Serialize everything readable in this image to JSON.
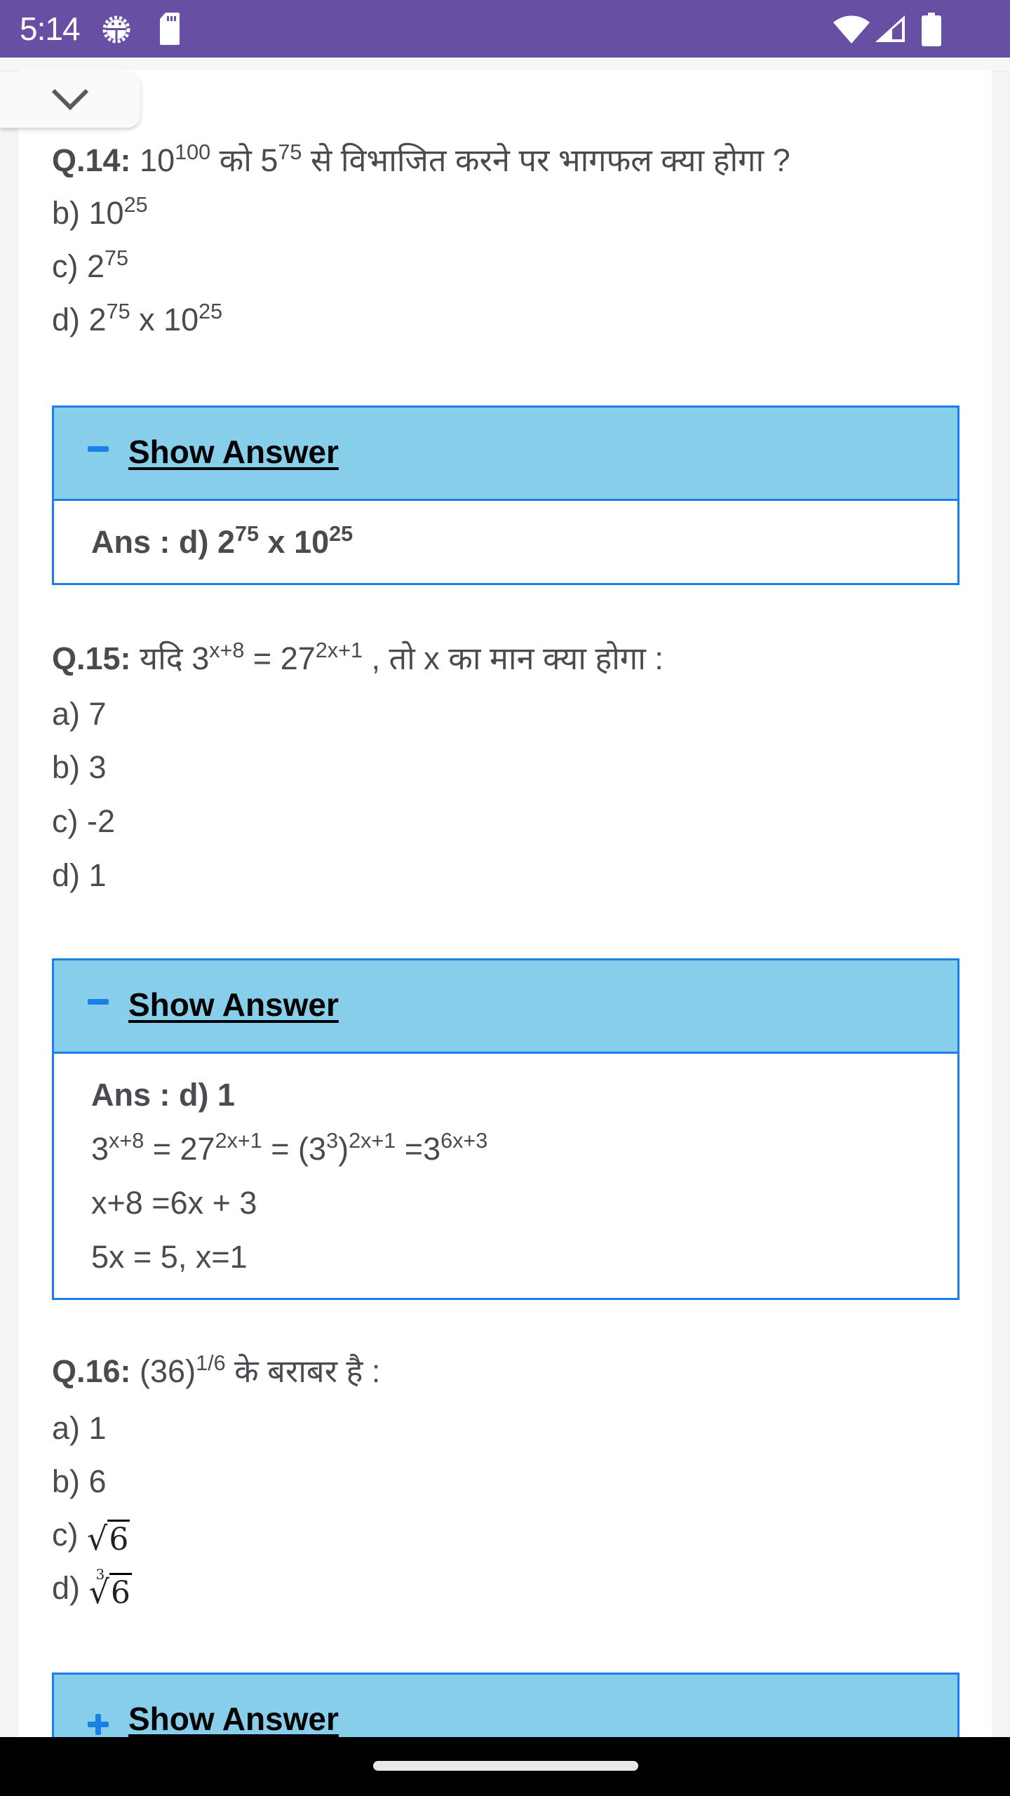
{
  "status_bar": {
    "time": "5:14",
    "left_icons": [
      "android-debug-icon",
      "sd-card-icon"
    ],
    "right_icons": [
      "wifi-icon",
      "cell-signal-icon",
      "battery-icon"
    ],
    "background_color": "#6750a4"
  },
  "collapse_tab": {
    "icon": "chevron-down-icon"
  },
  "colors": {
    "answer_header_bg": "#87ceeb",
    "answer_border": "#1a7fe8",
    "text": "#4a4b50"
  },
  "questions": [
    {
      "id": "Q.14:",
      "text_parts": [
        "10",
        "100",
        " को 5",
        "75",
        " से विभाजित करने पर भागफल क्या होगा ?"
      ],
      "options": [
        {
          "label": "b)",
          "base": "10",
          "exp": "25"
        },
        {
          "label": "c)",
          "base": "2",
          "exp": "75"
        },
        {
          "label": "d)",
          "base": "2",
          "exp": "75",
          "tail": " x 10",
          "tail_exp": "25"
        }
      ],
      "answer": {
        "toggle_label": "Show Answer",
        "expanded": true,
        "toggle_symbol": "minus-icon",
        "lines": [
          {
            "bold": true,
            "parts": [
              "Ans : d) 2",
              "75",
              " x 10",
              "25"
            ]
          }
        ]
      }
    },
    {
      "id": "Q.15:",
      "text_parts": [
        " यदि 3",
        "x+8",
        " = 27",
        "2x+1",
        " , तो x का मान क्या होगा :"
      ],
      "options": [
        {
          "label": "a)",
          "value": "7"
        },
        {
          "label": "b)",
          "value": "3"
        },
        {
          "label": "c)",
          "value": "-2"
        },
        {
          "label": "d)",
          "value": "1"
        }
      ],
      "answer": {
        "toggle_label": "Show Answer",
        "expanded": true,
        "toggle_symbol": "minus-icon",
        "lines": [
          {
            "bold": true,
            "parts": [
              "Ans : d) 1"
            ]
          },
          {
            "bold": false,
            "parts": [
              "3",
              "x+8",
              " = 27",
              "2x+1",
              " = (3",
              "3",
              ")",
              "2x+1",
              " =3",
              "6x+3"
            ]
          },
          {
            "bold": false,
            "parts": [
              "x+8 =6x + 3"
            ]
          },
          {
            "bold": false,
            "parts": [
              "5x = 5, x=1"
            ]
          }
        ]
      }
    },
    {
      "id": "Q.16:",
      "text_parts": [
        " (36)",
        "1/6",
        " के बराबर है :"
      ],
      "options": [
        {
          "label": "a)",
          "value": "1"
        },
        {
          "label": "b)",
          "value": "6"
        },
        {
          "label": "c)",
          "radicand": "6",
          "root_index": ""
        },
        {
          "label": "d)",
          "radicand": "6",
          "root_index": "3"
        }
      ],
      "answer": {
        "toggle_label": "Show Answer",
        "expanded": false,
        "toggle_symbol": "plus-icon"
      }
    }
  ]
}
